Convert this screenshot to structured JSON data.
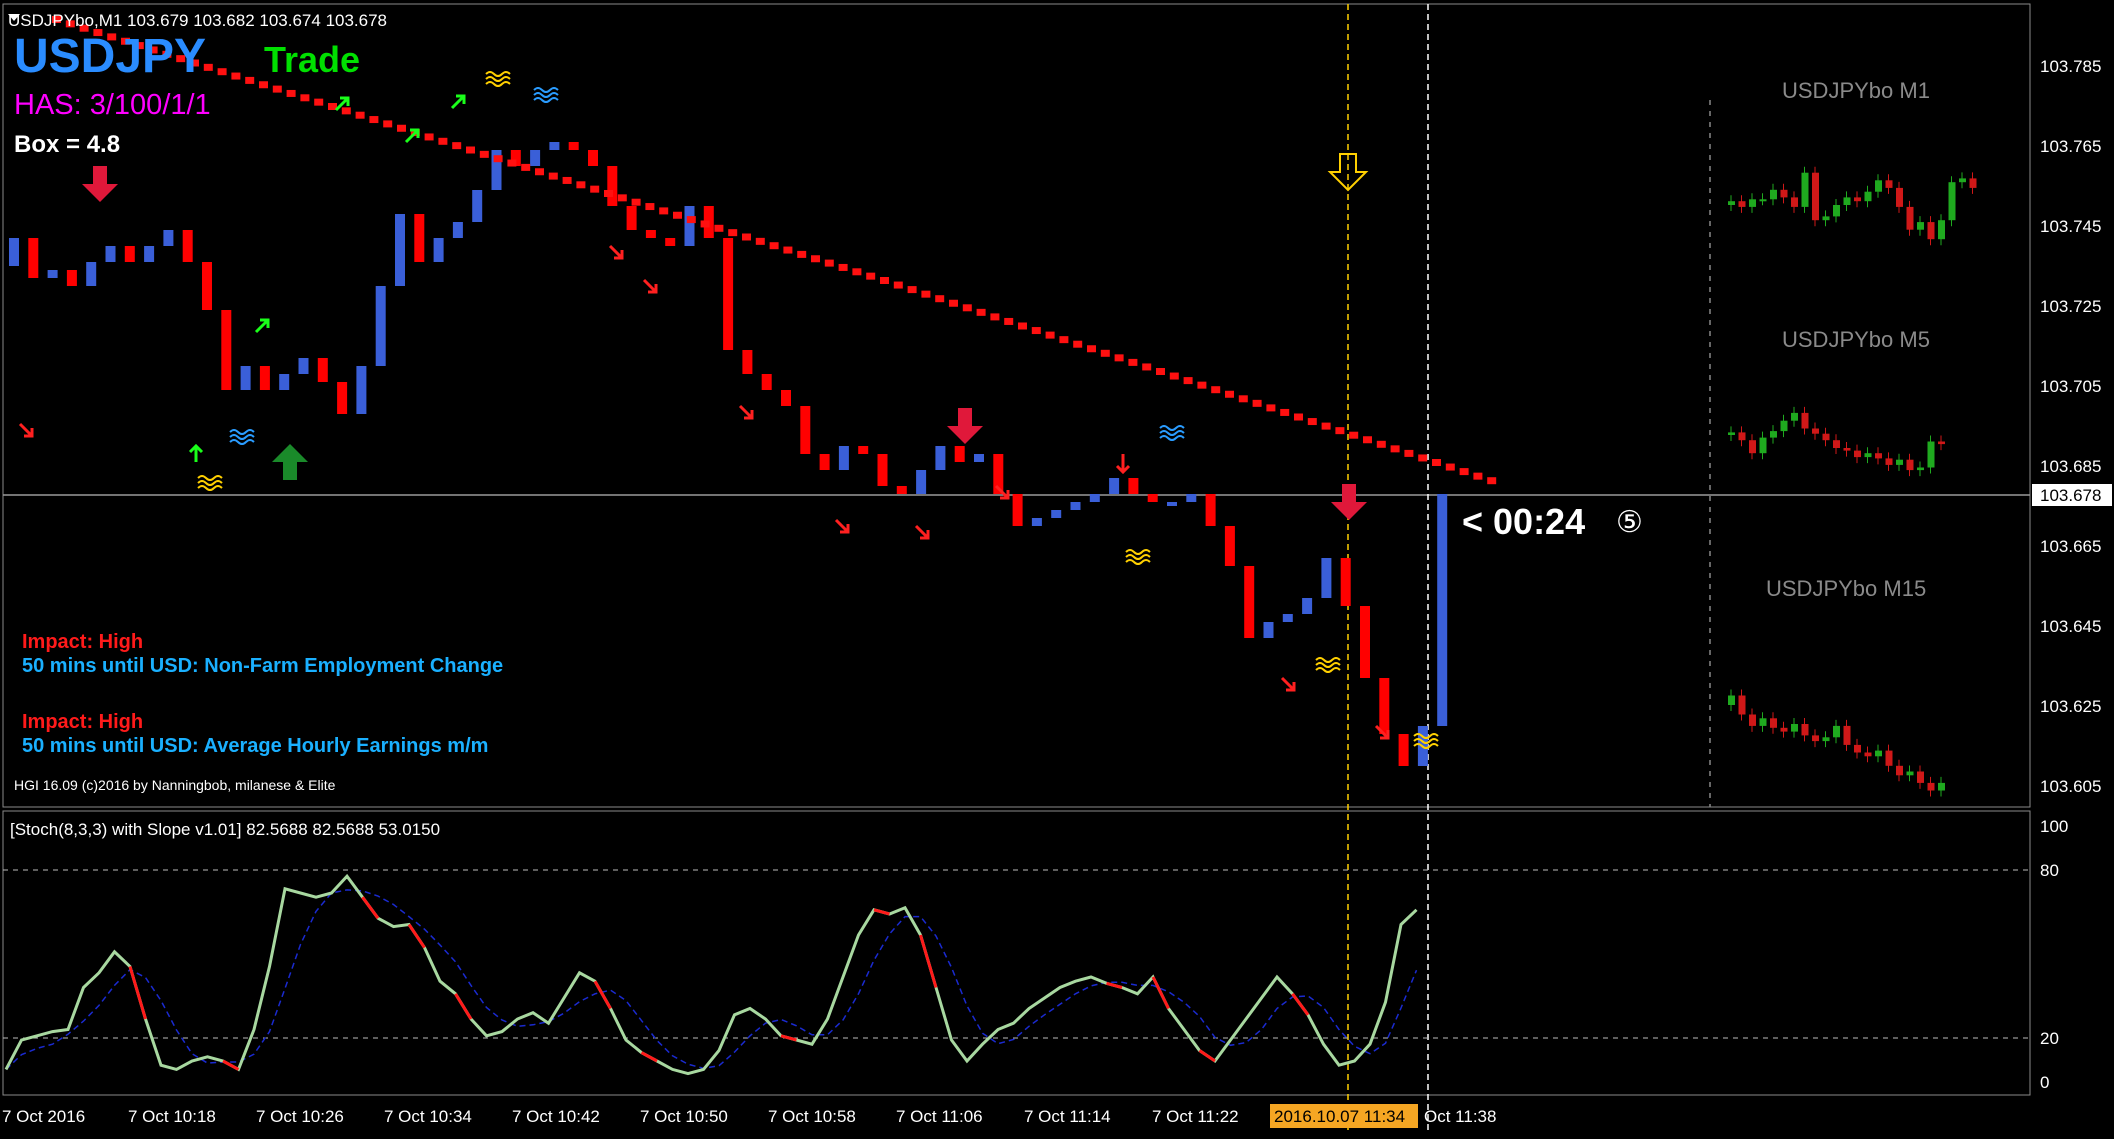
{
  "header": {
    "symbol_line": "USDJPYbo,M1  103.679 103.682 103.674 103.678",
    "symbol": "USDJPY",
    "mode": "Trade",
    "has": "HAS: 3/100/1/1",
    "box": "Box = 4.8"
  },
  "news": [
    {
      "impact": "Impact: High",
      "text": "50 mins until USD: Non-Farm Employment Change"
    },
    {
      "impact": "Impact: High",
      "text": "50 mins until USD: Average Hourly Earnings m/m"
    }
  ],
  "copyright": "HGI 16.09 (c)2016 by Nanningbob, milanese & Elite",
  "countdown": "< 00:24",
  "countdown_glyph": "⑤",
  "mini_titles": [
    "USDJPYbo M1",
    "USDJPYbo M5",
    "USDJPYbo M15"
  ],
  "price_axis": [
    "103.785",
    "103.765",
    "103.745",
    "103.725",
    "103.705",
    "103.685",
    "103.665",
    "103.645",
    "103.625",
    "103.605"
  ],
  "current_price": "103.678",
  "indicator": {
    "title": "[Stoch(8,3,3) with Slope v1.01] 82.5688 82.5688 53.0150",
    "axis": [
      "100",
      "80",
      "20",
      "0"
    ]
  },
  "time_axis": [
    "7 Oct 2016",
    "7 Oct 10:18",
    "7 Oct 10:26",
    "7 Oct 10:34",
    "7 Oct 10:42",
    "7 Oct 10:50",
    "7 Oct 10:58",
    "7 Oct 11:06",
    "7 Oct 11:14",
    "7 Oct 11:22",
    "2016.10.07 11:34",
    "Oct 11:38"
  ],
  "colors": {
    "bull": "#3a5fd8",
    "bear": "#ff0000",
    "stoch": "#a8d8a0",
    "signal": "#1a2ad0"
  },
  "chart_data": {
    "type": "candlestick",
    "ylim": [
      103.6,
      103.79
    ],
    "series": [
      {
        "name": "bars",
        "values": [
          [
            103.735,
            103.748,
            103.728,
            103.742
          ],
          [
            103.742,
            103.745,
            103.728,
            103.732
          ],
          [
            103.732,
            103.738,
            103.73,
            103.734
          ],
          [
            103.734,
            103.738,
            103.726,
            103.73
          ],
          [
            103.73,
            103.738,
            103.73,
            103.736
          ],
          [
            103.736,
            103.742,
            103.734,
            103.74
          ],
          [
            103.74,
            103.742,
            103.734,
            103.736
          ],
          [
            103.736,
            103.742,
            103.734,
            103.74
          ],
          [
            103.74,
            103.746,
            103.738,
            103.744
          ],
          [
            103.744,
            103.746,
            103.734,
            103.736
          ],
          [
            103.736,
            103.738,
            103.722,
            103.724
          ],
          [
            103.724,
            103.726,
            103.702,
            103.704
          ],
          [
            103.704,
            103.712,
            103.702,
            103.71
          ],
          [
            103.71,
            103.712,
            103.702,
            103.704
          ],
          [
            103.704,
            103.708,
            103.704,
            103.708
          ],
          [
            103.708,
            103.712,
            103.708,
            103.712
          ],
          [
            103.712,
            103.712,
            103.704,
            103.706
          ],
          [
            103.706,
            103.708,
            103.696,
            103.698
          ],
          [
            103.698,
            103.712,
            103.696,
            103.71
          ],
          [
            103.71,
            103.732,
            103.708,
            103.73
          ],
          [
            103.73,
            103.75,
            103.728,
            103.748
          ],
          [
            103.748,
            103.756,
            103.734,
            103.736
          ],
          [
            103.736,
            103.744,
            103.734,
            103.742
          ],
          [
            103.742,
            103.748,
            103.74,
            103.746
          ],
          [
            103.746,
            103.756,
            103.744,
            103.754
          ],
          [
            103.754,
            103.766,
            103.752,
            103.764
          ],
          [
            103.764,
            103.77,
            103.756,
            103.76
          ],
          [
            103.76,
            103.766,
            103.758,
            103.764
          ],
          [
            103.764,
            103.768,
            103.762,
            103.766
          ],
          [
            103.766,
            103.768,
            103.762,
            103.764
          ],
          [
            103.764,
            103.766,
            103.758,
            103.76
          ],
          [
            103.76,
            103.762,
            103.748,
            103.75
          ],
          [
            103.75,
            103.752,
            103.742,
            103.744
          ],
          [
            103.744,
            103.746,
            103.74,
            103.742
          ],
          [
            103.742,
            103.744,
            103.74,
            103.74
          ],
          [
            103.74,
            103.752,
            103.74,
            103.75
          ],
          [
            103.75,
            103.752,
            103.738,
            103.742
          ],
          [
            103.742,
            103.744,
            103.712,
            103.714
          ],
          [
            103.714,
            103.716,
            103.706,
            103.708
          ],
          [
            103.708,
            103.71,
            103.702,
            103.704
          ],
          [
            103.704,
            103.706,
            103.698,
            103.7
          ],
          [
            103.7,
            103.702,
            103.686,
            103.688
          ],
          [
            103.688,
            103.69,
            103.682,
            103.684
          ],
          [
            103.684,
            103.692,
            103.682,
            103.69
          ],
          [
            103.69,
            103.692,
            103.686,
            103.688
          ],
          [
            103.688,
            103.69,
            103.678,
            103.68
          ],
          [
            103.68,
            103.682,
            103.676,
            103.678
          ],
          [
            103.678,
            103.686,
            103.676,
            103.684
          ],
          [
            103.684,
            103.692,
            103.682,
            103.69
          ],
          [
            103.69,
            103.692,
            103.684,
            103.686
          ],
          [
            103.686,
            103.69,
            103.686,
            103.688
          ],
          [
            103.688,
            103.69,
            103.676,
            103.678
          ],
          [
            103.678,
            103.68,
            103.668,
            103.67
          ],
          [
            103.67,
            103.674,
            103.668,
            103.672
          ],
          [
            103.672,
            103.676,
            103.668,
            103.674
          ],
          [
            103.674,
            103.678,
            103.672,
            103.676
          ],
          [
            103.676,
            103.68,
            103.674,
            103.678
          ],
          [
            103.678,
            103.684,
            103.676,
            103.682
          ],
          [
            103.682,
            103.684,
            103.676,
            103.678
          ],
          [
            103.678,
            103.68,
            103.674,
            103.676
          ],
          [
            103.676,
            103.678,
            103.674,
            103.676
          ],
          [
            103.676,
            103.68,
            103.672,
            103.678
          ],
          [
            103.678,
            103.68,
            103.668,
            103.67
          ],
          [
            103.67,
            103.672,
            103.658,
            103.66
          ],
          [
            103.66,
            103.662,
            103.64,
            103.642
          ],
          [
            103.642,
            103.658,
            103.64,
            103.646
          ],
          [
            103.646,
            103.65,
            103.644,
            103.648
          ],
          [
            103.648,
            103.654,
            103.646,
            103.652
          ],
          [
            103.652,
            103.664,
            103.65,
            103.662
          ],
          [
            103.662,
            103.664,
            103.646,
            103.65
          ],
          [
            103.65,
            103.652,
            103.63,
            103.632
          ],
          [
            103.632,
            103.634,
            103.612,
            103.618
          ],
          [
            103.618,
            103.62,
            103.606,
            103.61
          ],
          [
            103.61,
            103.626,
            103.608,
            103.62
          ],
          [
            103.62,
            103.684,
            103.618,
            103.678
          ]
        ]
      }
    ]
  }
}
